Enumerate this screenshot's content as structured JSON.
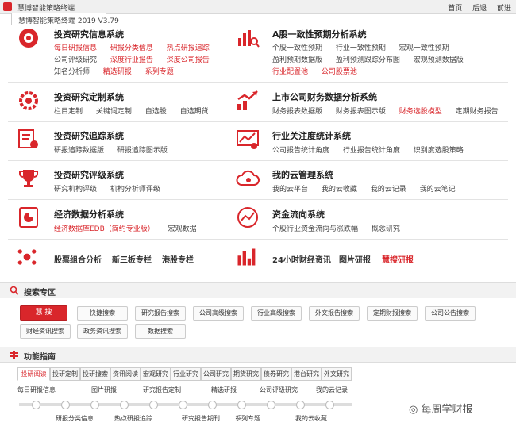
{
  "window": {
    "app_title": "慧博智能策略终端",
    "tab_title": "慧博智能策略终端 2019 V3.79"
  },
  "topnav": {
    "home": "首页",
    "back": "后退",
    "forward": "前进"
  },
  "systems": {
    "s1": {
      "title": "投资研究信息系统",
      "rows": [
        [
          "每日研报信息",
          "研报分类信息",
          "热点研报追踪"
        ],
        [
          "公司评级研究",
          "深度行业报告",
          "深度公司报告"
        ],
        [
          "知名分析师",
          "精选研报",
          "系列专题"
        ]
      ]
    },
    "s2": {
      "title": "A股一致性预期分析系统",
      "rows": [
        [
          "个股一致性预期",
          "行业一致性预期",
          "宏观一致性预期"
        ],
        [
          "盈利预期数据版",
          "盈利预测跟踪分布图",
          "宏观预测数据版"
        ],
        [
          "行业配置池",
          "公司股票池"
        ]
      ]
    },
    "s3": {
      "title": "投资研究定制系统",
      "rows": [
        [
          "栏目定制",
          "关键词定制",
          "自选股",
          "自选期货"
        ]
      ]
    },
    "s4": {
      "title": "上市公司财务数据分析系统",
      "rows": [
        [
          "财务报表数据版",
          "财务报表图示版",
          "财务选股模型",
          "定期财务报告"
        ]
      ]
    },
    "s5": {
      "title": "投资研究追踪系统",
      "rows": [
        [
          "研报追踪数据版",
          "研报追踪图示版"
        ]
      ]
    },
    "s6": {
      "title": "行业关注度统计系统",
      "rows": [
        [
          "公司报告统计角度",
          "行业报告统计角度",
          "识别度选股策略"
        ]
      ]
    },
    "s7": {
      "title": "投资研究评级系统",
      "rows": [
        [
          "研究机构评级",
          "机构分析师评级"
        ]
      ]
    },
    "s8": {
      "title": "我的云管理系统",
      "rows": [
        [
          "我的云平台",
          "我的云收藏",
          "我的云记录",
          "我的云笔记"
        ]
      ]
    },
    "s9": {
      "title": "经济数据分析系统",
      "rows": [
        [
          "经济数据库EDB（简约专业版）",
          "宏观数据"
        ]
      ]
    },
    "s10": {
      "title": "资金流向系统",
      "rows": [
        [
          "个股行业资金流向与涨跌幅",
          "概念研究"
        ]
      ]
    }
  },
  "bottom_links": {
    "a": "股票组合分析",
    "b": "新三板专栏",
    "c": "港股专栏",
    "d": "24小时财经资讯",
    "e": "图片研报",
    "f": "慧搜研报"
  },
  "search": {
    "section_title": "搜索专区",
    "main_button": "慧 搜",
    "buttons_row1": [
      "快捷搜索",
      "研究报告搜索",
      "公司高级搜索",
      "行业高级搜索",
      "外文报告搜索",
      "定期财报搜索",
      "公司公告搜索"
    ],
    "buttons_row2": [
      "财经资讯搜索",
      "政务资讯搜索",
      "数据搜索"
    ]
  },
  "guide": {
    "section_title": "功能指南",
    "tabs": [
      "投研阅读",
      "投研定制",
      "投研搜索",
      "资讯阅读",
      "宏观研究",
      "行业研究",
      "公司研究",
      "期货研究",
      "债券研究",
      "港台研究",
      "外文研究"
    ],
    "timeline_top": [
      "每日研报信息",
      "图片研报",
      "研究报告定制",
      "精选研报",
      "公司评级研究",
      "我的云记录"
    ],
    "timeline_bottom": [
      "研报分类信息",
      "热点研报追踪",
      "研究报告期刊",
      "系列专题",
      "我的云收藏"
    ]
  },
  "watermark": "每周学财报",
  "colors": {
    "accent": "#d9262b"
  }
}
